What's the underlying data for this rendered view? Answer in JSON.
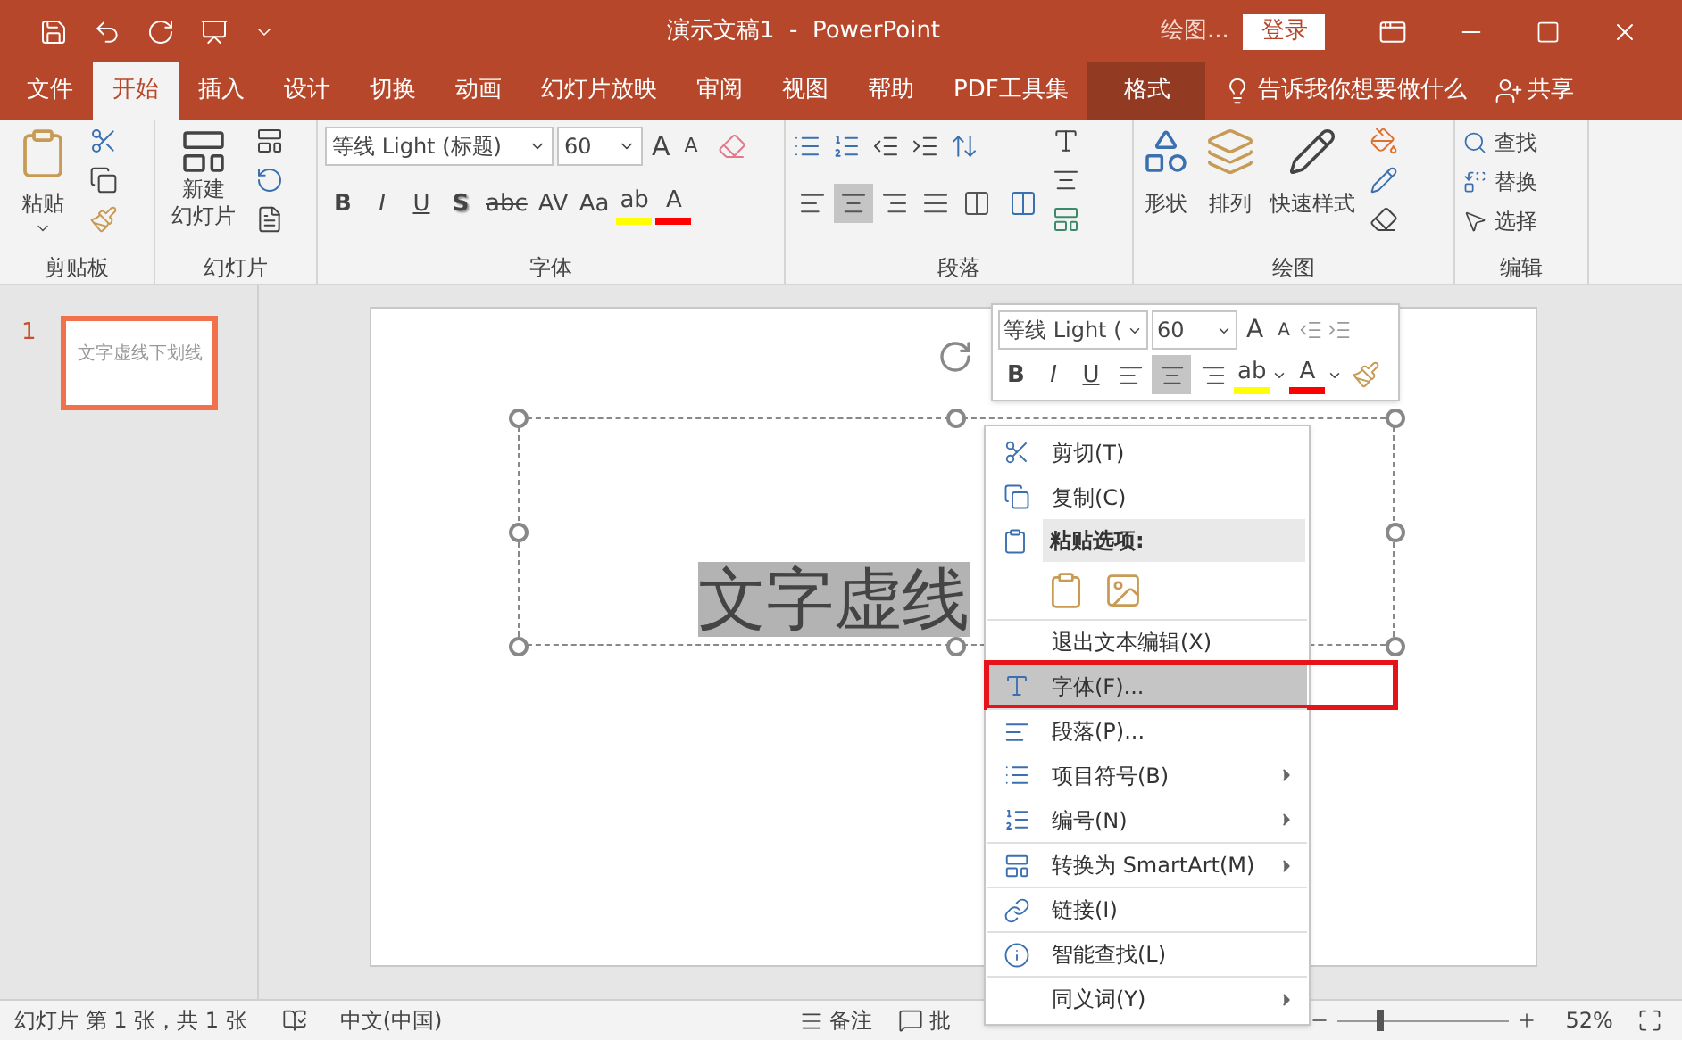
{
  "title_bar": {
    "title": "演示文稿1  -  PowerPoint",
    "context_label": "绘图...",
    "sign_in": "登录"
  },
  "tabs": [
    {
      "label": "文件",
      "selected": false,
      "contextual": false
    },
    {
      "label": "开始",
      "selected": true,
      "contextual": false
    },
    {
      "label": "插入",
      "selected": false,
      "contextual": false
    },
    {
      "label": "设计",
      "selected": false,
      "contextual": false
    },
    {
      "label": "切换",
      "selected": false,
      "contextual": false
    },
    {
      "label": "动画",
      "selected": false,
      "contextual": false
    },
    {
      "label": "幻灯片放映",
      "selected": false,
      "contextual": false
    },
    {
      "label": "审阅",
      "selected": false,
      "contextual": false
    },
    {
      "label": "视图",
      "selected": false,
      "contextual": false
    },
    {
      "label": "帮助",
      "selected": false,
      "contextual": false
    },
    {
      "label": "PDF工具集",
      "selected": false,
      "contextual": false
    },
    {
      "label": "格式",
      "selected": false,
      "contextual": true
    }
  ],
  "tell_me": "告诉我你想要做什么",
  "share": "共享",
  "ribbon": {
    "clipboard": {
      "paste": "粘贴",
      "group": "剪贴板"
    },
    "slides": {
      "new_slide": [
        "新建",
        "幻灯片"
      ],
      "group": "幻灯片"
    },
    "font": {
      "font_name": "等线 Light (标题)",
      "font_size": "60",
      "grow": "A",
      "shrink": "A",
      "group": "字体",
      "buttons": [
        {
          "label": "B",
          "kind": "bold"
        },
        {
          "label": "I",
          "kind": "italic"
        },
        {
          "label": "U",
          "kind": "underline"
        },
        {
          "label": "S",
          "kind": "shadow"
        },
        {
          "label": "abc",
          "kind": "strike"
        },
        {
          "label": "AV",
          "kind": "spacing"
        },
        {
          "label": "Aa",
          "kind": "case"
        },
        {
          "label": "ab",
          "kind": "highlight",
          "color": "#ffff00"
        },
        {
          "label": "A",
          "kind": "font-color",
          "color": "#ff0000"
        }
      ]
    },
    "paragraph": {
      "group": "段落",
      "alignments": [
        {
          "kind": "left",
          "selected": false
        },
        {
          "kind": "center",
          "selected": true
        },
        {
          "kind": "right",
          "selected": false
        },
        {
          "kind": "justify",
          "selected": false
        },
        {
          "kind": "distributed",
          "selected": false
        }
      ]
    },
    "drawing": {
      "shapes": "形状",
      "arrange": "排列",
      "quick_styles": "快速样式",
      "group": "绘图"
    },
    "editing": {
      "find": "查找",
      "replace": "替换",
      "select": "选择",
      "group": "编辑"
    }
  },
  "thumbnails": [
    {
      "number": "1",
      "text": "文字虚线下划线",
      "selected": true
    }
  ],
  "slide": {
    "selected_text": "文字虚线"
  },
  "mini_toolbar": {
    "font_name": "等线 Light (",
    "font_size": "60",
    "grow": "A",
    "shrink": "A",
    "buttons": [
      {
        "label": "B",
        "kind": "bold"
      },
      {
        "label": "I",
        "kind": "italic"
      },
      {
        "label": "U",
        "kind": "underline"
      }
    ],
    "alignments": [
      {
        "kind": "left",
        "selected": false
      },
      {
        "kind": "center",
        "selected": true
      },
      {
        "kind": "right",
        "selected": false
      }
    ],
    "highlight": {
      "label": "ab",
      "color": "#ffff00"
    },
    "font_color": {
      "label": "A",
      "color": "#ff0000"
    }
  },
  "context_menu": [
    {
      "kind": "item",
      "label": "剪切(T)",
      "selected": false,
      "submenu": false,
      "divider_above": false,
      "outlined": false
    },
    {
      "kind": "item",
      "label": "复制(C)",
      "selected": false,
      "submenu": false,
      "divider_above": false,
      "outlined": false
    },
    {
      "kind": "header",
      "label": "粘贴选项:"
    },
    {
      "kind": "paste-icons"
    },
    {
      "kind": "item",
      "label": "退出文本编辑(X)",
      "selected": false,
      "submenu": false,
      "divider_above": true,
      "outlined": false
    },
    {
      "kind": "item",
      "label": "字体(F)...",
      "selected": true,
      "submenu": false,
      "divider_above": false,
      "outlined": true
    },
    {
      "kind": "item",
      "label": "段落(P)...",
      "selected": false,
      "submenu": false,
      "divider_above": true,
      "outlined": false
    },
    {
      "kind": "item",
      "label": "项目符号(B)",
      "selected": false,
      "submenu": true,
      "divider_above": false,
      "outlined": false
    },
    {
      "kind": "item",
      "label": "编号(N)",
      "selected": false,
      "submenu": true,
      "divider_above": false,
      "outlined": false
    },
    {
      "kind": "item",
      "label": "转换为 SmartArt(M)",
      "selected": false,
      "submenu": true,
      "divider_above": true,
      "outlined": false
    },
    {
      "kind": "item",
      "label": "链接(I)",
      "selected": false,
      "submenu": false,
      "divider_above": true,
      "outlined": false
    },
    {
      "kind": "item",
      "label": "智能查找(L)",
      "selected": false,
      "submenu": false,
      "divider_above": true,
      "outlined": false
    },
    {
      "kind": "item",
      "label": "同义词(Y)",
      "selected": false,
      "submenu": true,
      "divider_above": true,
      "outlined": false
    }
  ],
  "status_bar": {
    "slide_info": "幻灯片 第 1 张，共 1 张",
    "language": "中文(中国)",
    "notes": "备注",
    "comments": "批",
    "zoom": "52%",
    "zoom_slider": {
      "level": 0.25
    }
  }
}
